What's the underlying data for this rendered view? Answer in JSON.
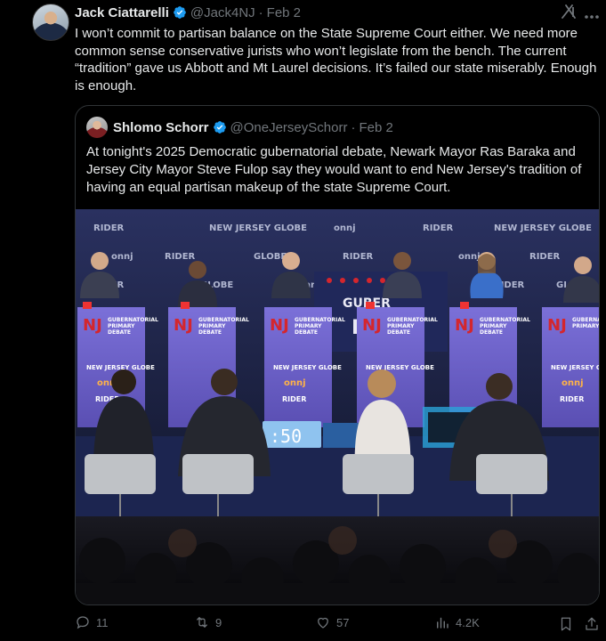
{
  "tweet": {
    "author_name": "Jack Ciattarelli",
    "handle": "@Jack4NJ",
    "separator": "·",
    "date": "Feb 2",
    "text": "I won’t commit to partisan balance on the State Supreme Court either. We need more common sense conservative jurists who won’t legislate from the bench. The current “tradition” gave us Abbott and Mt Laurel decisions. It’s failed our state miserably. Enough is enough.",
    "verified_color": "#1d9bf0"
  },
  "quote": {
    "author_name": "Shlomo Schorr",
    "handle": "@OneJerseySchorr",
    "separator": "·",
    "date": "Feb 2",
    "text": "At tonight's 2025 Democratic gubernatorial debate, Newark Mayor Ras Baraka and Jersey City Mayor Steve Fulop say they would want to end New Jersey's tradition of having an equal partisan makeup of the state Supreme Court.",
    "photo": {
      "backdrop_logos": [
        "RIDER UNIVERSITY",
        "NEW JERSEY GLOBE",
        "onnj"
      ],
      "podium_title": "NJ GUBERNATORIAL PRIMARY DEBATE",
      "podium_logo": "NJ",
      "podium_line1": "GUBERNATORIAL",
      "podium_line2": "PRIMARY",
      "podium_line3": "DEBATE",
      "sponsor_globe": "NEW JERSEY GLOBE",
      "sponsor_onnj": "onnj",
      "sponsor_rider": "RIDER",
      "screen_time": ":50",
      "colors": {
        "backdrop": "#1b2345",
        "podium": "#6e63c9",
        "nj_red": "#d4262d"
      }
    }
  },
  "actions": {
    "replies": "11",
    "retweets": "9",
    "likes": "57",
    "views": "4.2K"
  },
  "icons": [
    "grok-icon",
    "more-icon",
    "verified-icon",
    "reply-icon",
    "retweet-icon",
    "like-icon",
    "views-icon",
    "bookmark-icon",
    "share-icon"
  ]
}
